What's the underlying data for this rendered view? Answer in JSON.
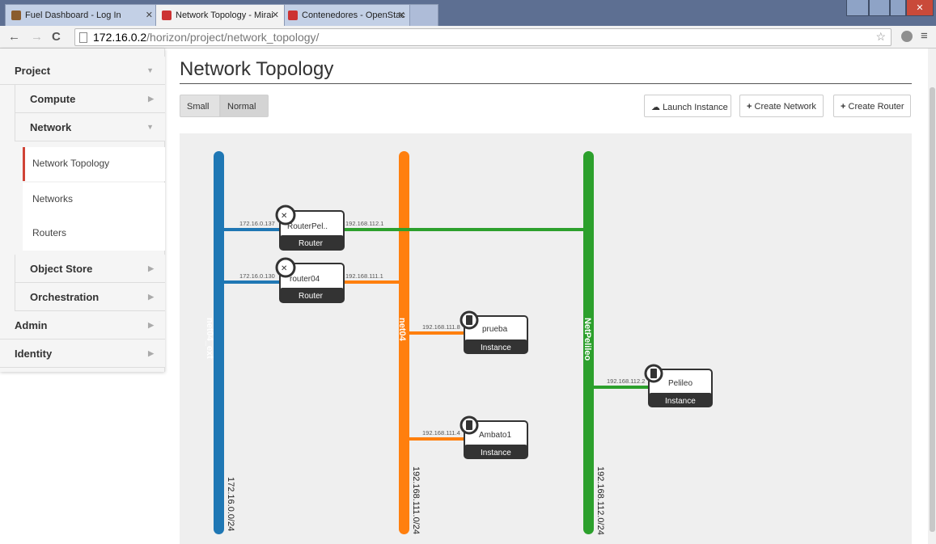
{
  "browser": {
    "tabs": [
      {
        "title": "Fuel Dashboard - Log In"
      },
      {
        "title": "Network Topology - Mirai"
      },
      {
        "title": "Contenedores - OpenStac"
      }
    ],
    "url_host": "172.16.0.2",
    "url_path": "/horizon/project/network_topology/"
  },
  "sidebar": {
    "project": "Project",
    "compute": "Compute",
    "network": "Network",
    "items": [
      "Network Topology",
      "Networks",
      "Routers"
    ],
    "object_store": "Object Store",
    "orchestration": "Orchestration",
    "admin": "Admin",
    "identity": "Identity"
  },
  "main": {
    "title": "Network Topology",
    "size_small": "Small",
    "size_normal": "Normal",
    "launch_instance": "Launch Instance",
    "create_network": "Create Network",
    "create_router": "Create Router"
  },
  "topology": {
    "colors": {
      "net04_ext": "#1f77b4",
      "net04": "#ff7f0e",
      "netpelileo": "#2ca02c"
    },
    "networks": [
      {
        "name": "net04_ext",
        "cidr": "172.16.0.0/24"
      },
      {
        "name": "net04",
        "cidr": "192.168.111.0/24"
      },
      {
        "name": "NetPelileo",
        "cidr": "192.168.112.0/24"
      }
    ],
    "routers": [
      {
        "name": "RouterPel..",
        "type": "Router",
        "ext_ip": "172.16.0.137",
        "int_ip": "192.168.112.1"
      },
      {
        "name": "router04",
        "type": "Router",
        "ext_ip": "172.16.0.130",
        "int_ip": "192.168.111.1"
      }
    ],
    "instances": [
      {
        "name": "prueba",
        "type": "Instance",
        "ip": "192.168.111.8"
      },
      {
        "name": "Ambato1",
        "type": "Instance",
        "ip": "192.168.111.4"
      },
      {
        "name": "Pelileo",
        "type": "Instance",
        "ip": "192.168.112.2"
      }
    ]
  }
}
